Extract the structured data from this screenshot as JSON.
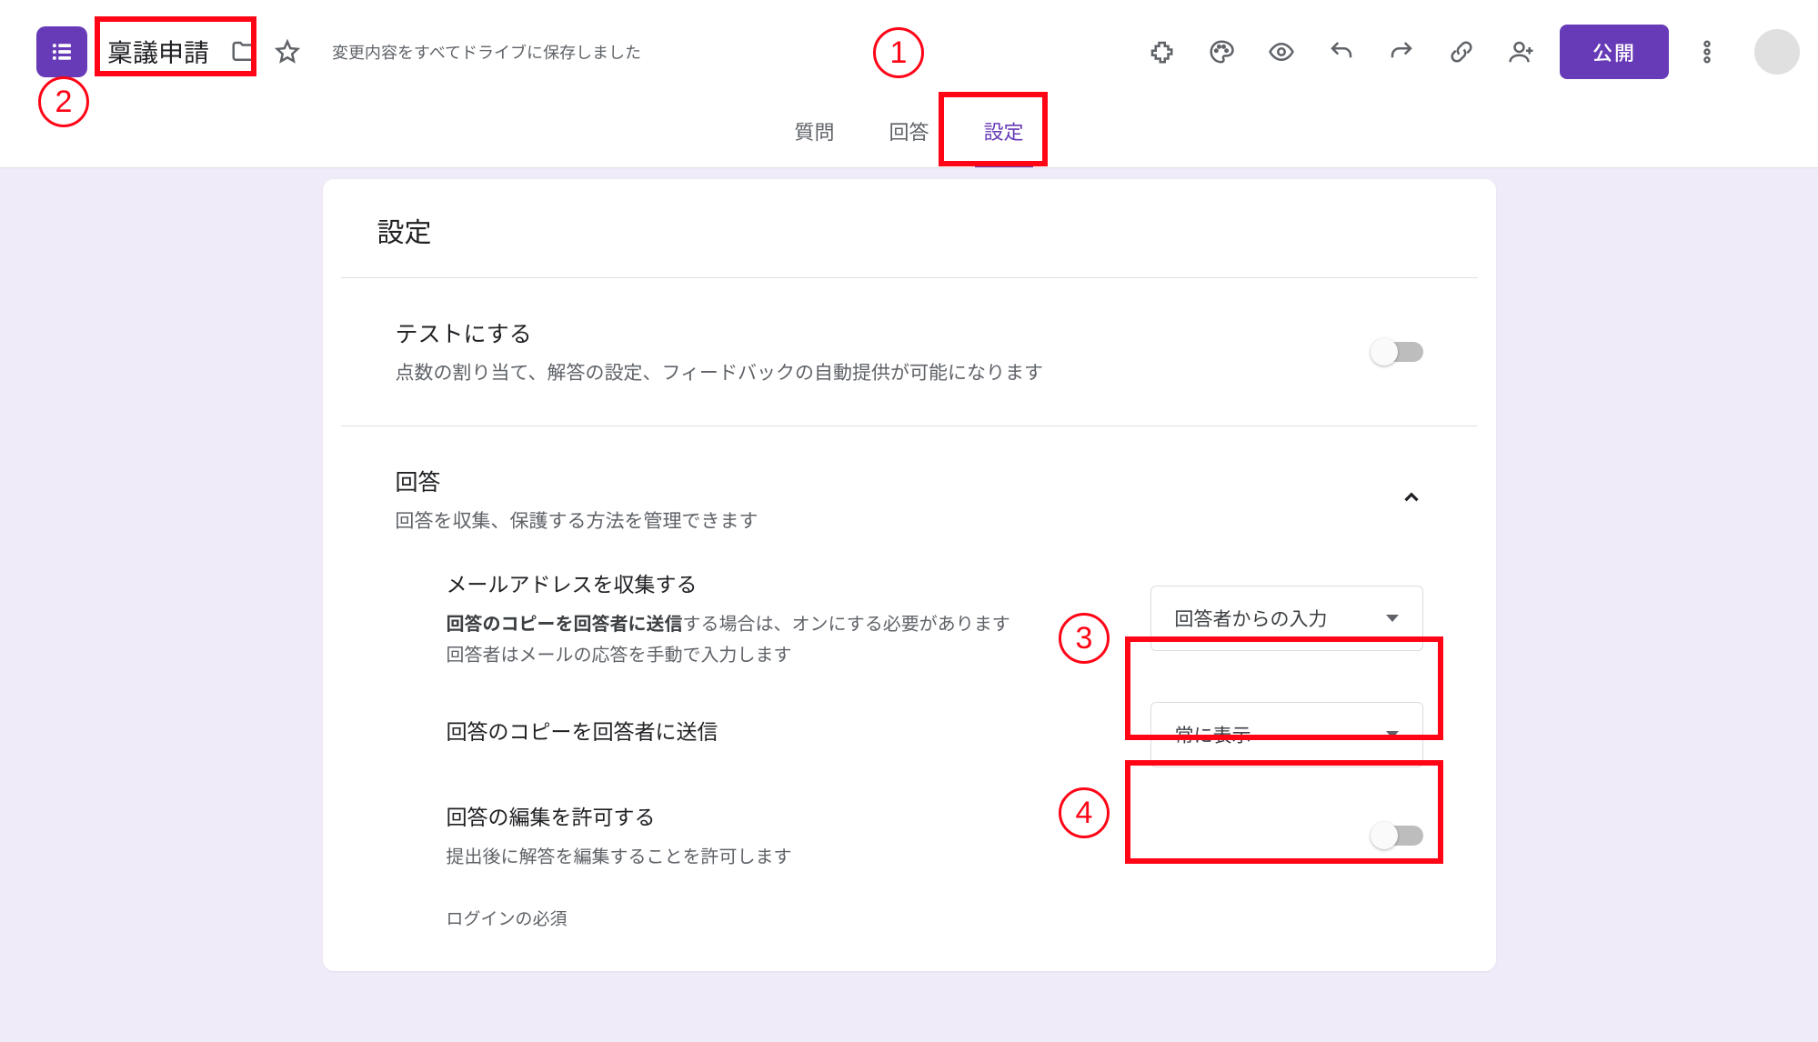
{
  "header": {
    "title": "稟議申請",
    "save_status": "変更内容をすべてドライブに保存しました",
    "publish": "公開"
  },
  "tabs": {
    "questions": "質問",
    "responses": "回答",
    "settings": "設定"
  },
  "card": {
    "title": "設定"
  },
  "quiz": {
    "title": "テストにする",
    "desc": "点数の割り当て、解答の設定、フィードバックの自動提供が可能になります"
  },
  "responses": {
    "title": "回答",
    "desc": "回答を収集、保護する方法を管理できます",
    "collect": {
      "title": "メールアドレスを収集する",
      "desc_bold": "回答のコピーを回答者に送信",
      "desc_rest": "する場合は、オンにする必要があります",
      "desc2": "回答者はメールの応答を手動で入力します",
      "dropdown": "回答者からの入力"
    },
    "sendcopy": {
      "title": "回答のコピーを回答者に送信",
      "dropdown": "常に表示"
    },
    "editafter": {
      "title": "回答の編集を許可する",
      "desc": "提出後に解答を編集することを許可します"
    },
    "login_required": "ログインの必須"
  },
  "annotations": {
    "n1": "1",
    "n2": "2",
    "n3": "3",
    "n4": "4"
  }
}
